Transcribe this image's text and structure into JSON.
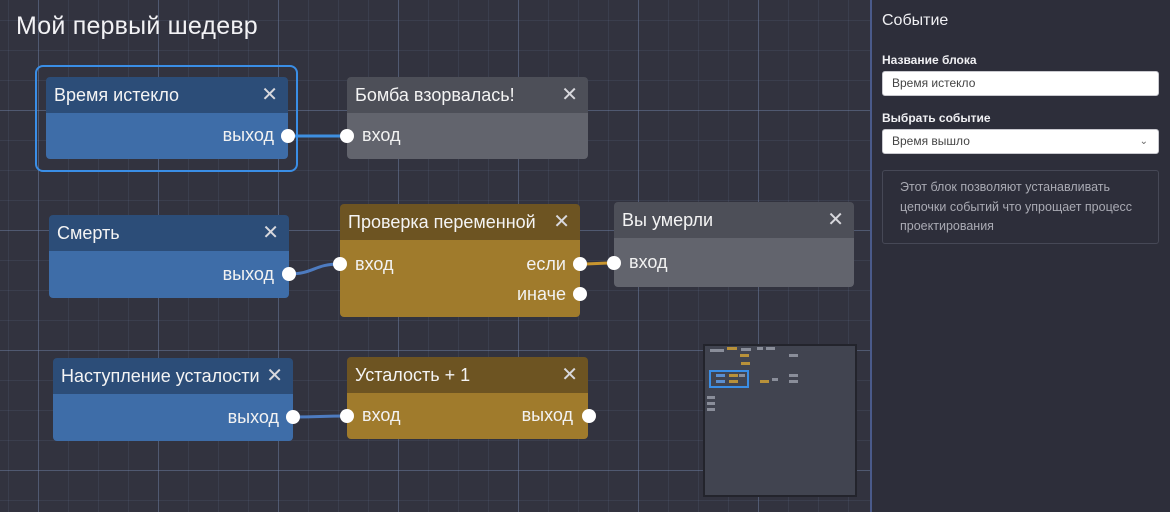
{
  "canvas": {
    "title": "Мой первый шедевр",
    "close_glyph": "✕",
    "nodes": [
      {
        "id": "time-expired",
        "title": "Время истекло",
        "color": "blue",
        "outputs": [
          "выход"
        ],
        "inputs": [],
        "selected": true
      },
      {
        "id": "bomb",
        "title": "Бомба взорвалась!",
        "color": "gray",
        "inputs": [
          "вход"
        ],
        "outputs": []
      },
      {
        "id": "death",
        "title": "Смерть",
        "color": "blue",
        "outputs": [
          "выход"
        ],
        "inputs": []
      },
      {
        "id": "check-var",
        "title": "Проверка переменной",
        "color": "gold",
        "inputs": [
          "вход"
        ],
        "outputs": [
          "если",
          "иначе"
        ]
      },
      {
        "id": "you-died",
        "title": "Вы умерли",
        "color": "gray",
        "inputs": [
          "вход"
        ],
        "outputs": []
      },
      {
        "id": "fatigue-start",
        "title": "Наступление усталости",
        "color": "blue",
        "outputs": [
          "выход"
        ],
        "inputs": []
      },
      {
        "id": "fatigue-plus",
        "title": "Усталость + 1",
        "color": "gold",
        "inputs": [
          "вход"
        ],
        "outputs": [
          "выход"
        ]
      }
    ]
  },
  "colors": {
    "event_blue": "#3e6da8",
    "action_gray": "#62646d",
    "logic_gold": "#a07b2c",
    "selection": "#3a8ee6"
  },
  "sidebar": {
    "title": "Событие",
    "block_name_label": "Название блока",
    "block_name_value": "Время истекло",
    "event_select_label": "Выбрать событие",
    "event_select_value": "Время вышло",
    "note": "Этот блок позволяют устанавливать цепочки событий что упрощает процесс проектирования"
  },
  "icons": {
    "close": "close-icon",
    "select": "chevron-down-icon"
  }
}
